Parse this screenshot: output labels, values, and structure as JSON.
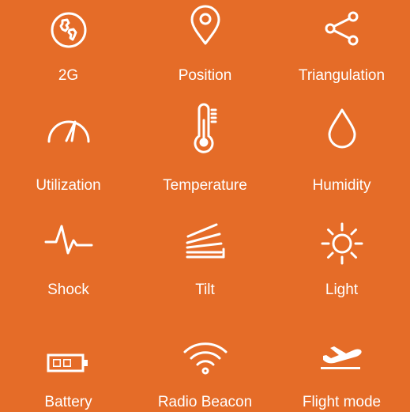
{
  "background_color": "#E56C28",
  "icon_color": "#FFFFFF",
  "tiles": [
    {
      "icon": "globe-icon",
      "label": "2G"
    },
    {
      "icon": "location-pin-icon",
      "label": "Position"
    },
    {
      "icon": "share-nodes-icon",
      "label": "Triangulation"
    },
    {
      "icon": "gauge-icon",
      "label": "Utilization"
    },
    {
      "icon": "thermometer-icon",
      "label": "Temperature"
    },
    {
      "icon": "droplet-icon",
      "label": "Humidity"
    },
    {
      "icon": "pulse-icon",
      "label": "Shock"
    },
    {
      "icon": "tilt-icon",
      "label": "Tilt"
    },
    {
      "icon": "sun-icon",
      "label": "Light"
    },
    {
      "icon": "battery-icon",
      "label": "Battery"
    },
    {
      "icon": "wifi-icon",
      "label": "Radio Beacon"
    },
    {
      "icon": "airplane-takeoff-icon",
      "label": "Flight mode"
    }
  ]
}
